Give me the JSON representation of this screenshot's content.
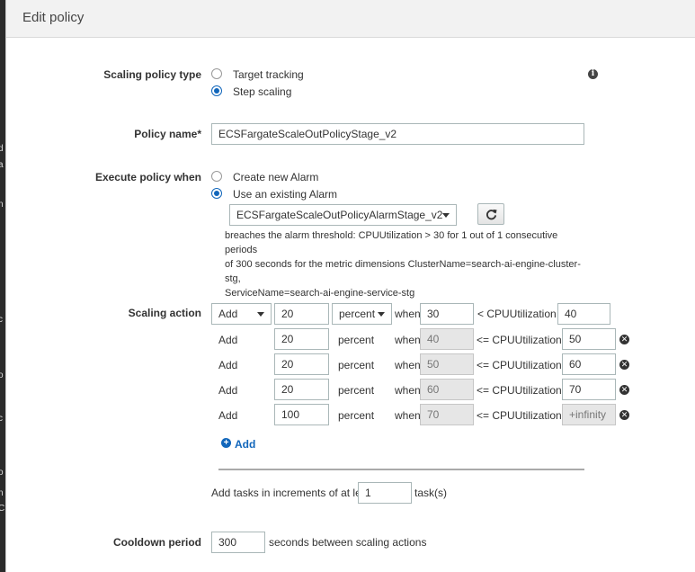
{
  "modal": {
    "title": "Edit policy"
  },
  "background_strip": [
    "d",
    "a",
    "n",
    "c",
    "o",
    "c",
    "o",
    "n",
    "C"
  ],
  "policy_type": {
    "label": "Scaling policy type",
    "options": [
      {
        "label": "Target tracking",
        "checked": false
      },
      {
        "label": "Step scaling",
        "checked": true
      }
    ],
    "info_icon": "info-icon"
  },
  "policy_name": {
    "label": "Policy name*",
    "value": "ECSFargateScaleOutPolicyStage_v2"
  },
  "execute_policy": {
    "label": "Execute policy when",
    "options": [
      {
        "label": "Create new Alarm",
        "checked": false
      },
      {
        "label": "Use an existing Alarm",
        "checked": true
      }
    ],
    "alarm_selected": "ECSFargateScaleOutPolicyAlarmStage_v2",
    "refresh_icon": "refresh-icon",
    "description_lines": [
      "breaches the alarm threshold: CPUUtilization > 30 for 1 out of 1 consecutive periods",
      "of 300 seconds for the metric dimensions ClusterName=search-ai-engine-cluster-stg,",
      "ServiceName=search-ai-engine-service-stg"
    ]
  },
  "scaling_action": {
    "label": "Scaling action",
    "steps": [
      {
        "action": "Add",
        "amount": "20",
        "unit": "percent",
        "when": "when",
        "lower": "30",
        "op": "< CPUUtilization <",
        "upper": "40"
      },
      {
        "action": "Add",
        "amount": "20",
        "unit": "percent",
        "when": "when",
        "lower": "40",
        "op": "<= CPUUtilization <",
        "upper": "50"
      },
      {
        "action": "Add",
        "amount": "20",
        "unit": "percent",
        "when": "when",
        "lower": "50",
        "op": "<= CPUUtilization <",
        "upper": "60"
      },
      {
        "action": "Add",
        "amount": "20",
        "unit": "percent",
        "when": "when",
        "lower": "60",
        "op": "<= CPUUtilization <",
        "upper": "70"
      },
      {
        "action": "Add",
        "amount": "100",
        "unit": "percent",
        "when": "when",
        "lower": "70",
        "op": "<= CPUUtilization <",
        "upper": "+infinity"
      }
    ],
    "add_label": "Add"
  },
  "increments": {
    "prefix": "Add tasks in increments of at least",
    "value": "1",
    "suffix": "task(s)"
  },
  "cooldown": {
    "label": "Cooldown period",
    "value": "300",
    "suffix": "seconds between scaling actions"
  },
  "colors": {
    "accent": "#1166bb",
    "header_bg": "#f2f2f2",
    "readonly_bg": "#e6e6e6"
  }
}
